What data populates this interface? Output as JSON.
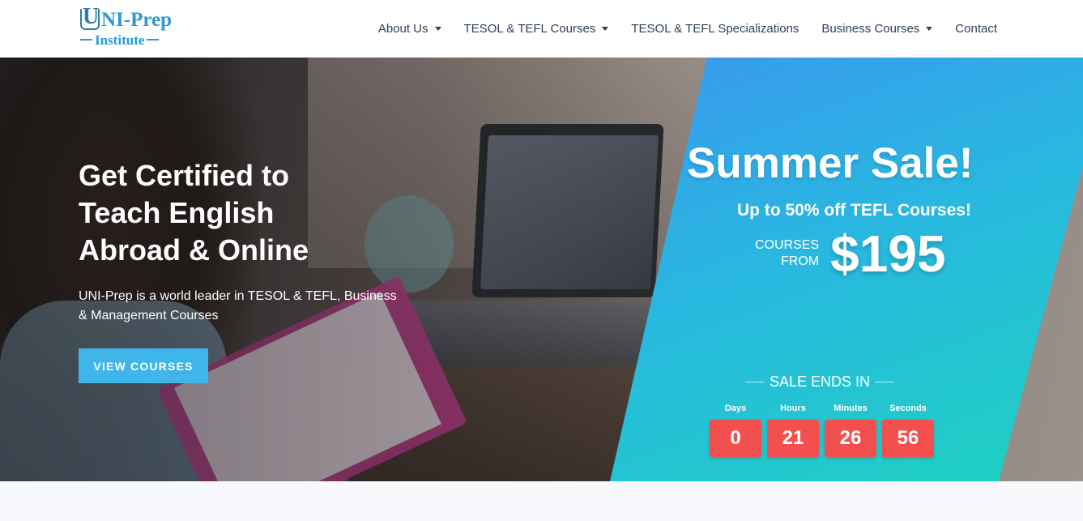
{
  "header": {
    "logo": {
      "top_letter": "U",
      "top_rest": "NI-Prep",
      "bottom": "Institute"
    },
    "nav": [
      {
        "label": "About Us",
        "has_dropdown": true
      },
      {
        "label": "TESOL & TEFL Courses",
        "has_dropdown": true
      },
      {
        "label": "TESOL & TEFL Specializations",
        "has_dropdown": false
      },
      {
        "label": "Business Courses",
        "has_dropdown": true
      },
      {
        "label": "Contact",
        "has_dropdown": false
      }
    ]
  },
  "hero": {
    "title_line1": "Get Certified to",
    "title_line2": "Teach English",
    "title_line3": "Abroad & Online",
    "subtitle": "UNI-Prep is a world leader in TESOL & TEFL, Business & Management Courses",
    "cta_label": "VIEW COURSES"
  },
  "sale": {
    "title": "Summer Sale!",
    "discount_text": "Up to 50% off TEFL Courses!",
    "from_label_line1": "COURSES",
    "from_label_line2": "FROM",
    "price": "$195",
    "ends_label": "SALE ENDS IN",
    "countdown": [
      {
        "label": "Days",
        "value": "0"
      },
      {
        "label": "Hours",
        "value": "21"
      },
      {
        "label": "Minutes",
        "value": "26"
      },
      {
        "label": "Seconds",
        "value": "56"
      }
    ]
  },
  "colors": {
    "brand_blue": "#2b9ad2",
    "cta_blue": "#3fb5ea",
    "countdown_red": "#f2504f",
    "nav_text": "#2e3f55",
    "sale_gradient_start": "#3a98ee",
    "sale_gradient_end": "#1fd3c0"
  }
}
